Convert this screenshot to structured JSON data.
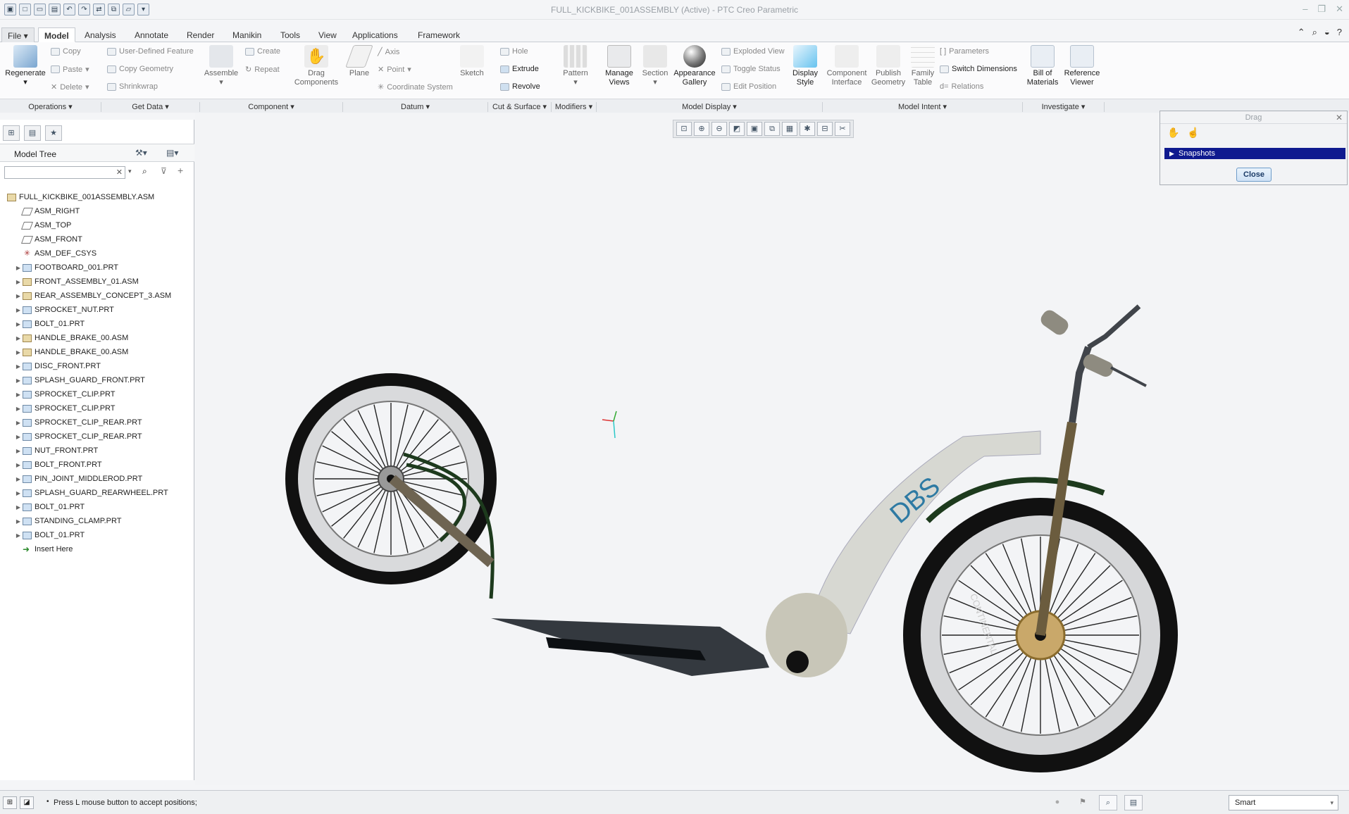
{
  "window": {
    "title": "FULL_KICKBIKE_001ASSEMBLY (Active) - PTC Creo Parametric"
  },
  "tabs": [
    "File",
    "Model",
    "Analysis",
    "Annotate",
    "Render",
    "Manikin",
    "Tools",
    "View",
    "Applications",
    "Framework"
  ],
  "ribbon": {
    "regenerate": "Regenerate",
    "copy": "Copy",
    "paste": "Paste",
    "delete": "Delete",
    "udf": "User-Defined Feature",
    "copy_geometry": "Copy Geometry",
    "shrinkwrap": "Shrinkwrap",
    "assemble": "Assemble",
    "create": "Create",
    "repeat": "Repeat",
    "drag_components": "Drag Components",
    "plane": "Plane",
    "axis": "Axis",
    "point": "Point",
    "coord_system": "Coordinate System",
    "sketch": "Sketch",
    "hole": "Hole",
    "extrude": "Extrude",
    "revolve": "Revolve",
    "pattern": "Pattern",
    "manage_views": "Manage Views",
    "section": "Section",
    "appearance_gallery": "Appearance Gallery",
    "exploded_view": "Exploded View",
    "toggle_status": "Toggle Status",
    "edit_position": "Edit Position",
    "display_style": "Display Style",
    "component_interface": "Component Interface",
    "publish_geometry": "Publish Geometry",
    "family_table": "Family Table",
    "parameters": "Parameters",
    "switch_dimensions": "Switch Dimensions",
    "relations": "Relations",
    "bill_of_materials": "Bill of Materials",
    "reference_viewer": "Reference Viewer"
  },
  "groups": [
    "Operations",
    "Get Data",
    "Component",
    "Datum",
    "Cut & Surface",
    "Modifiers",
    "Model Display",
    "Model Intent",
    "Investigate"
  ],
  "model_tree": {
    "title": "Model Tree",
    "items": [
      {
        "label": "FULL_KICKBIKE_001ASSEMBLY.ASM",
        "kind": "root"
      },
      {
        "label": "ASM_RIGHT",
        "kind": "plane"
      },
      {
        "label": "ASM_TOP",
        "kind": "plane"
      },
      {
        "label": "ASM_FRONT",
        "kind": "plane"
      },
      {
        "label": "ASM_DEF_CSYS",
        "kind": "csys"
      },
      {
        "label": "FOOTBOARD_001.PRT",
        "kind": "part"
      },
      {
        "label": "FRONT_ASSEMBLY_01.ASM",
        "kind": "asm"
      },
      {
        "label": "REAR_ASSEMBLY_CONCEPT_3.ASM",
        "kind": "asm"
      },
      {
        "label": "SPROCKET_NUT.PRT",
        "kind": "part"
      },
      {
        "label": "BOLT_01.PRT",
        "kind": "part"
      },
      {
        "label": "HANDLE_BRAKE_00.ASM",
        "kind": "asm"
      },
      {
        "label": "HANDLE_BRAKE_00.ASM",
        "kind": "asm"
      },
      {
        "label": "DISC_FRONT.PRT",
        "kind": "part"
      },
      {
        "label": "SPLASH_GUARD_FRONT.PRT",
        "kind": "part"
      },
      {
        "label": "SPROCKET_CLIP.PRT",
        "kind": "part"
      },
      {
        "label": "SPROCKET_CLIP.PRT",
        "kind": "part"
      },
      {
        "label": "SPROCKET_CLIP_REAR.PRT",
        "kind": "part"
      },
      {
        "label": "SPROCKET_CLIP_REAR.PRT",
        "kind": "part"
      },
      {
        "label": "NUT_FRONT.PRT",
        "kind": "part"
      },
      {
        "label": "BOLT_FRONT.PRT",
        "kind": "part"
      },
      {
        "label": "PIN_JOINT_MIDDLEROD.PRT",
        "kind": "part"
      },
      {
        "label": "SPLASH_GUARD_REARWHEEL.PRT",
        "kind": "part"
      },
      {
        "label": "BOLT_01.PRT",
        "kind": "part"
      },
      {
        "label": "STANDING_CLAMP.PRT",
        "kind": "part"
      },
      {
        "label": "BOLT_01.PRT",
        "kind": "part"
      },
      {
        "label": "Insert Here",
        "kind": "insert"
      }
    ]
  },
  "drag_dialog": {
    "title": "Drag",
    "snapshots": "Snapshots",
    "close": "Close"
  },
  "model": {
    "logo_text": "DBS",
    "tire_text": "CONTINENTAL"
  },
  "status": {
    "message": "Press L mouse button to accept positions;",
    "filter": "Smart"
  }
}
